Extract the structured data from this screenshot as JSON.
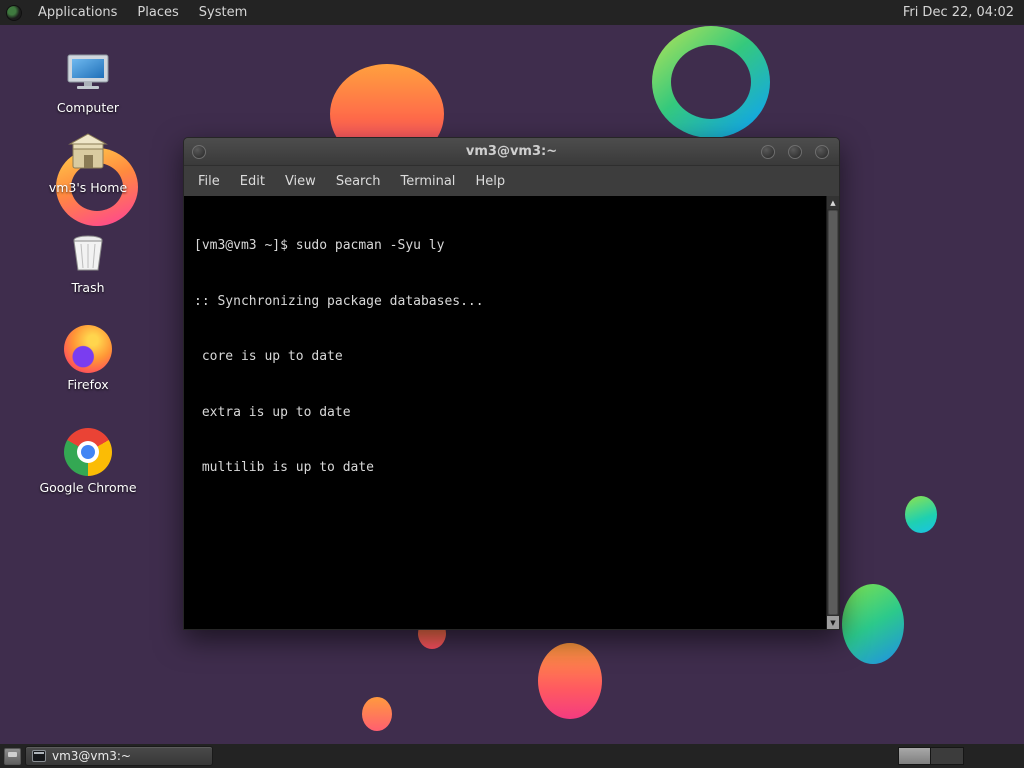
{
  "top_panel": {
    "menus": [
      {
        "label": "Applications"
      },
      {
        "label": "Places"
      },
      {
        "label": "System"
      }
    ],
    "clock": "Fri Dec 22, 04:02"
  },
  "desktop": {
    "icons": [
      {
        "label": "Computer"
      },
      {
        "label": "vm3's Home"
      },
      {
        "label": "Trash"
      },
      {
        "label": "Firefox"
      },
      {
        "label": "Google Chrome"
      }
    ]
  },
  "terminal_window": {
    "title": "vm3@vm3:~",
    "menu_items": [
      "File",
      "Edit",
      "View",
      "Search",
      "Terminal",
      "Help"
    ],
    "lines": [
      "[vm3@vm3 ~]$ sudo pacman -Syu ly",
      ":: Synchronizing package databases...",
      " core is up to date",
      " extra is up to date",
      " multilib is up to date"
    ]
  },
  "taskbar": {
    "window_button": "vm3@vm3:~"
  },
  "colors": {
    "desktop_bg": "#3f2d4d",
    "panel_bg": "#232323",
    "terminal_bg": "#000000",
    "terminal_fg": "#d8d8d8",
    "titlebar": "#434343"
  }
}
